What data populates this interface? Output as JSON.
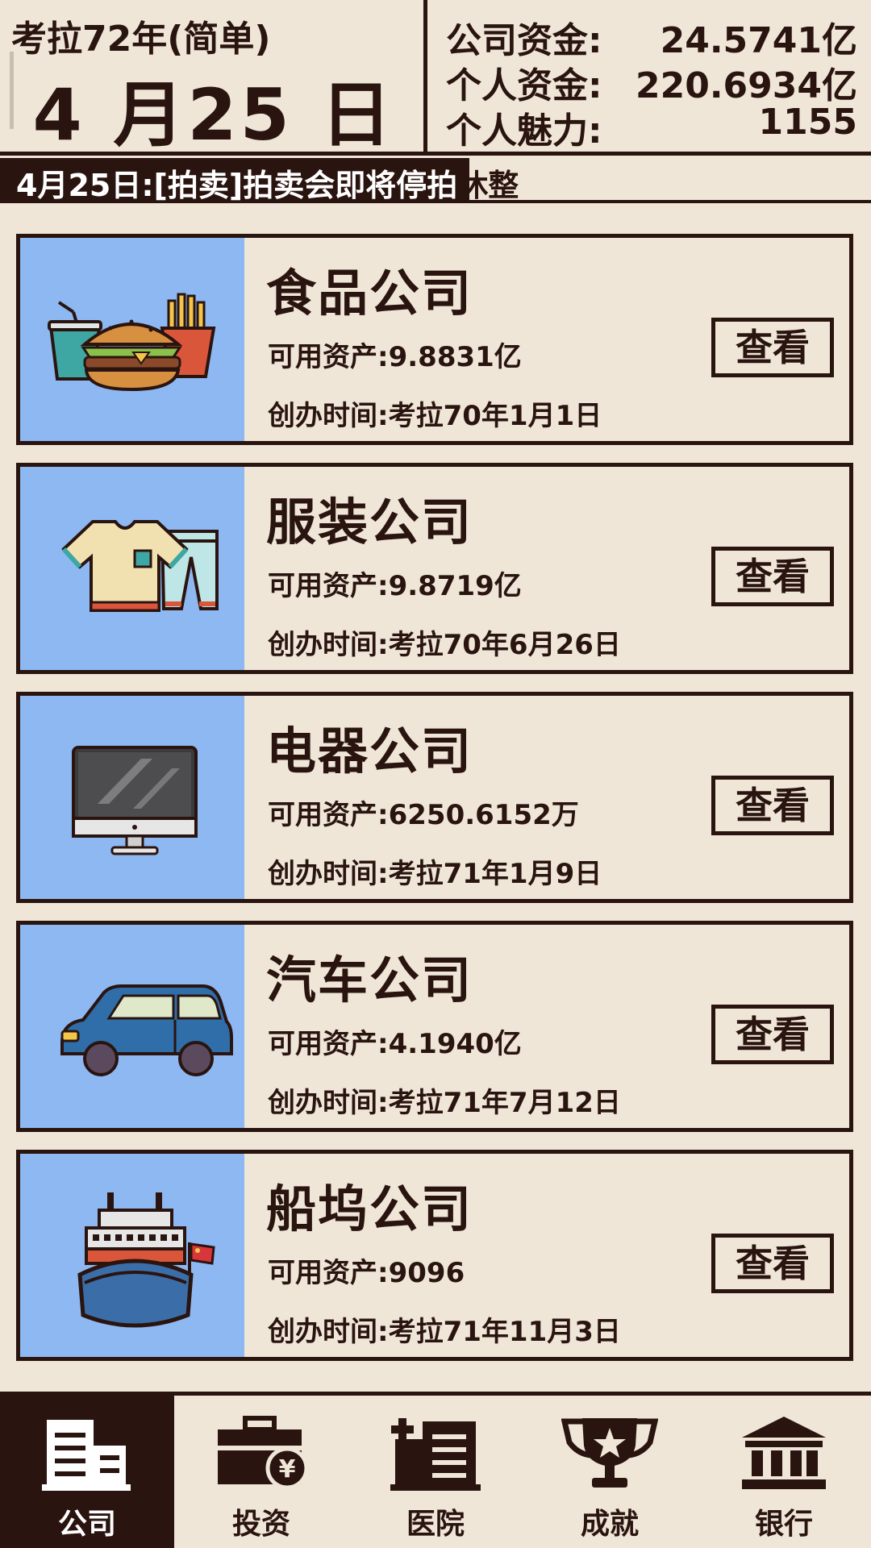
{
  "header": {
    "year_line": "考拉72年(简单)",
    "date_line": "4 月25 日",
    "stats": [
      {
        "label": "公司资金:",
        "value": "24.5741亿"
      },
      {
        "label": "个人资金:",
        "value": "220.6934亿"
      },
      {
        "label": "个人魅力:",
        "value": "1155"
      }
    ]
  },
  "ticker": {
    "message_highlight": "4月25日:[拍卖]拍卖会即将停拍",
    "message_tail": "休整"
  },
  "companies": [
    {
      "name": "食品公司",
      "assets": "可用资产:9.8831亿",
      "founded": "创办时间:考拉70年1月1日",
      "icon": "food-icon",
      "button": "查看"
    },
    {
      "name": "服装公司",
      "assets": "可用资产:9.8719亿",
      "founded": "创办时间:考拉70年6月26日",
      "icon": "clothing-icon",
      "button": "查看"
    },
    {
      "name": "电器公司",
      "assets": "可用资产:6250.6152万",
      "founded": "创办时间:考拉71年1月9日",
      "icon": "monitor-icon",
      "button": "查看"
    },
    {
      "name": "汽车公司",
      "assets": "可用资产:4.1940亿",
      "founded": "创办时间:考拉71年7月12日",
      "icon": "car-icon",
      "button": "查看"
    },
    {
      "name": "船坞公司",
      "assets": "可用资产:9096",
      "founded": "创办时间:考拉71年11月3日",
      "icon": "ship-icon",
      "button": "查看"
    }
  ],
  "nav": [
    {
      "label": "公司",
      "icon": "building-icon",
      "active": true
    },
    {
      "label": "投资",
      "icon": "briefcase-yen-icon",
      "active": false
    },
    {
      "label": "医院",
      "icon": "hospital-icon",
      "active": false
    },
    {
      "label": "成就",
      "icon": "trophy-icon",
      "active": false
    },
    {
      "label": "银行",
      "icon": "bank-icon",
      "active": false
    }
  ],
  "colors": {
    "background": "#efe6d8",
    "ink": "#2a1410",
    "thumb_bg": "#8db8f1"
  }
}
